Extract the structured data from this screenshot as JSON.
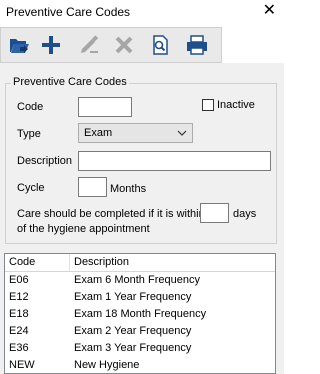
{
  "window": {
    "title": "Preventive Care Codes",
    "close_glyph": "✕"
  },
  "toolbar": {
    "buttons": [
      {
        "name": "open-icon",
        "enabled": true
      },
      {
        "name": "add-icon",
        "enabled": true
      },
      {
        "name": "edit-icon",
        "enabled": false
      },
      {
        "name": "delete-icon",
        "enabled": false
      },
      {
        "name": "preview-icon",
        "enabled": true
      },
      {
        "name": "print-icon",
        "enabled": true
      }
    ]
  },
  "form": {
    "group_title": "Preventive Care Codes",
    "code_label": "Code",
    "code_value": "",
    "inactive_label": "Inactive",
    "inactive_checked": false,
    "type_label": "Type",
    "type_value": "Exam",
    "description_label": "Description",
    "description_value": "",
    "cycle_label": "Cycle",
    "cycle_value": "",
    "months_label": "Months",
    "care_line1": "Care should be completed if it is within",
    "care_line2": "of the hygiene appointment",
    "days_value": "",
    "days_label": "days"
  },
  "list": {
    "columns": [
      "Code",
      "Description"
    ],
    "rows": [
      {
        "code": "E06",
        "description": "Exam  6 Month Frequency"
      },
      {
        "code": "E12",
        "description": "Exam 1 Year Frequency"
      },
      {
        "code": "E18",
        "description": "Exam  18 Month Frequency"
      },
      {
        "code": "E24",
        "description": "Exam 2 Year Frequency"
      },
      {
        "code": "E36",
        "description": "Exam  3 Year Frequency"
      },
      {
        "code": "NEW",
        "description": "New Hygiene"
      }
    ]
  },
  "colors": {
    "accent_blue": "#1f4e8c",
    "disabled_gray": "#a6a6a6"
  }
}
